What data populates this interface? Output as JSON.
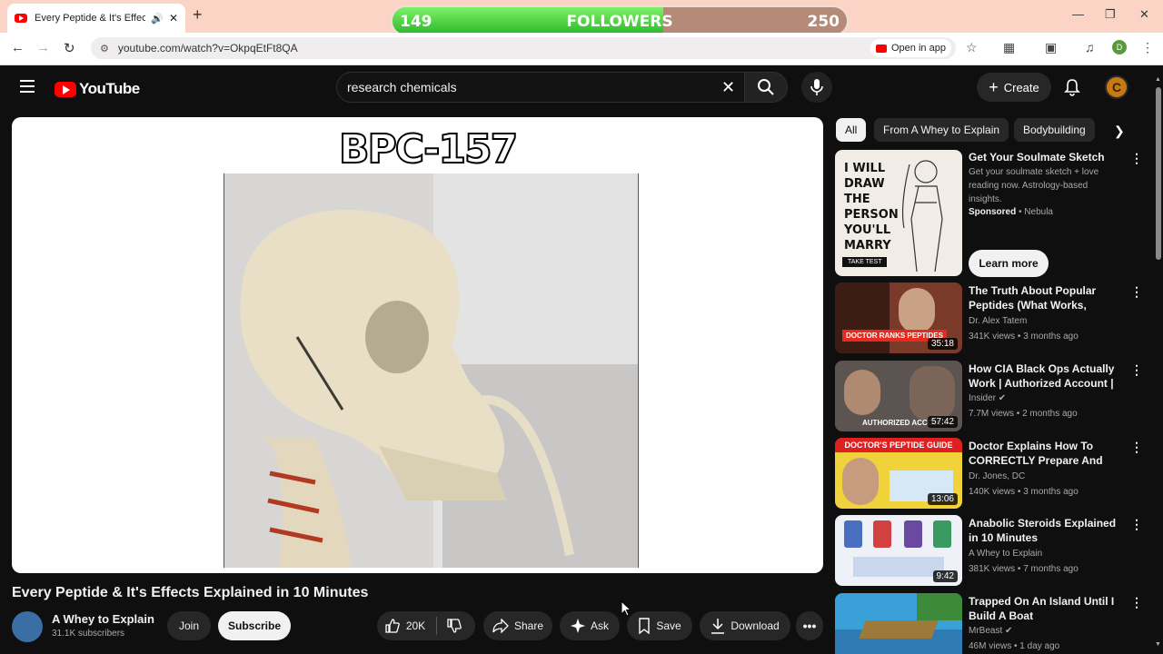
{
  "browser": {
    "tab_title": "Every Peptide & It's Effects E",
    "url": "youtube.com/watch?v=OkpqEtFt8QA",
    "open_in_app": "Open in app",
    "profile_initial": "D"
  },
  "overlay": {
    "followers_current": "149",
    "followers_label": "FOLLOWERS",
    "followers_goal": "250",
    "progress_fraction": 0.596
  },
  "header": {
    "logo_text": "YouTube",
    "search_value": "research chemicals",
    "create_label": "Create",
    "avatar_letter": "C"
  },
  "video": {
    "overlay_text": "BPC-157",
    "title": "Every Peptide & It's Effects Explained in 10 Minutes",
    "channel": "A Whey to Explain",
    "subscribers": "31.1K subscribers",
    "join_label": "Join",
    "subscribe_label": "Subscribe",
    "likes": "20K",
    "share_label": "Share",
    "ask_label": "Ask",
    "save_label": "Save",
    "download_label": "Download"
  },
  "chips": [
    "All",
    "From A Whey to Explain",
    "Bodybuilding"
  ],
  "ad": {
    "thumb_text": "I WILL DRAW THE PERSON YOU'LL MARRY",
    "thumb_button": "TAKE TEST",
    "title": "Get Your Soulmate Sketch",
    "description": "Get your soulmate sketch + love reading now. Astrology-based insights.",
    "sponsored": "Sponsored",
    "advertiser": "Nebula",
    "learn_more": "Learn more"
  },
  "recommendations": [
    {
      "title": "The Truth About Popular Peptides (What Works, What's...",
      "channel": "Dr. Alex Tatem",
      "meta": "341K views • 3 months ago",
      "duration": "35:18",
      "thumb_caption": "DOCTOR RANKS PEPTIDES",
      "verified": false
    },
    {
      "title": "How CIA Black Ops Actually Work | Authorized Account | ...",
      "channel": "Insider",
      "meta": "7.7M views • 2 months ago",
      "duration": "57:42",
      "thumb_caption": "AUTHORIZED ACCOUNT",
      "verified": true
    },
    {
      "title": "Doctor Explains How To CORRECTLY Prepare And Inje...",
      "channel": "Dr. Jones, DC",
      "meta": "140K views • 3 months ago",
      "duration": "13:06",
      "thumb_caption": "DOCTOR'S PEPTIDE GUIDE",
      "verified": false
    },
    {
      "title": "Anabolic Steroids Explained in 10 Minutes",
      "channel": "A Whey to Explain",
      "meta": "381K views • 7 months ago",
      "duration": "9:42",
      "thumb_caption": "",
      "verified": false
    },
    {
      "title": "Trapped On An Island Until I Build A Boat",
      "channel": "MrBeast",
      "meta": "46M views • 1 day ago",
      "duration": "",
      "thumb_caption": "",
      "verified": true
    }
  ],
  "colors": {
    "background": "#0f0f0f",
    "accent": "#ff0000",
    "progress_green": "#2bb82a",
    "tabbar": "#fbd4c6"
  }
}
